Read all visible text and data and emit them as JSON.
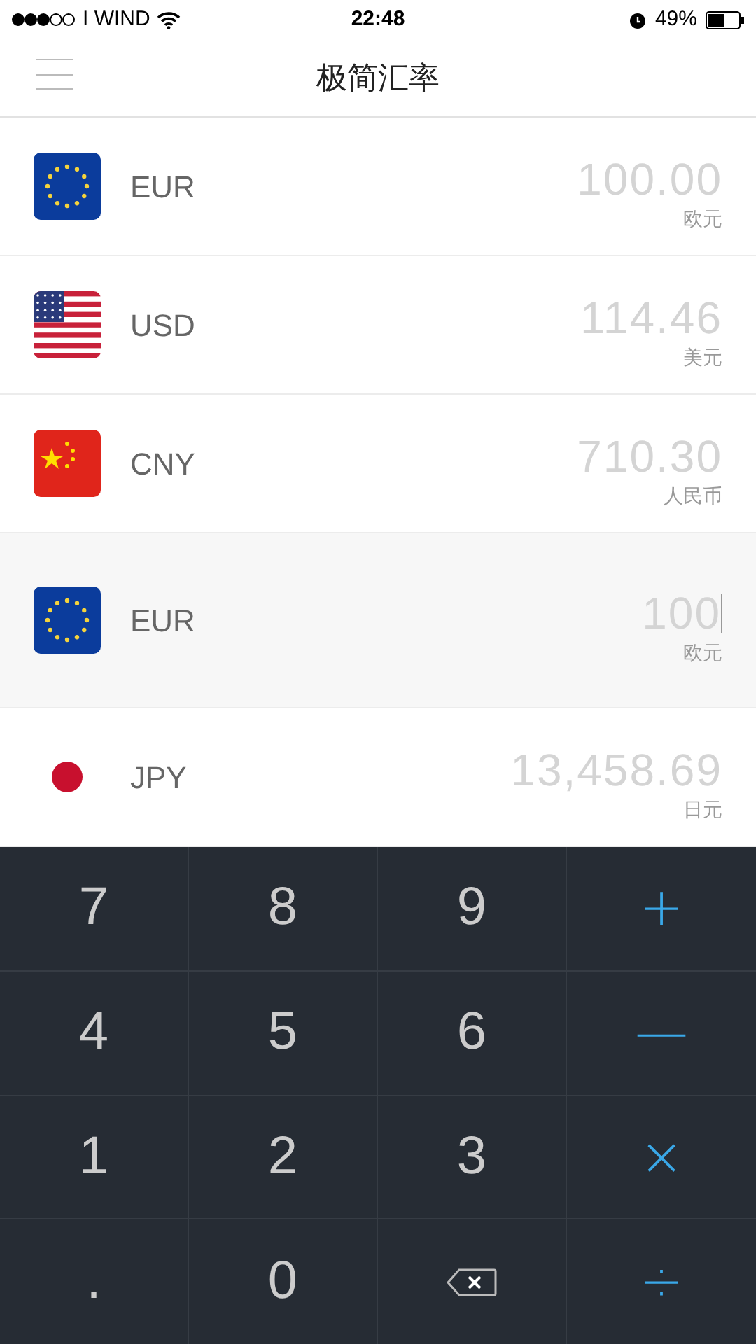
{
  "status_bar": {
    "carrier": "I WIND",
    "time": "22:48",
    "battery": "49%"
  },
  "header": {
    "title": "极简汇率"
  },
  "rows": [
    {
      "kind": "eu",
      "code": "EUR",
      "amount": "100.00",
      "name": "欧元",
      "selected": false
    },
    {
      "kind": "us",
      "code": "USD",
      "amount": "114.46",
      "name": "美元",
      "selected": false
    },
    {
      "kind": "cn",
      "code": "CNY",
      "amount": "710.30",
      "name": "人民币",
      "selected": false
    },
    {
      "kind": "eu",
      "code": "EUR",
      "amount": "100",
      "name": "欧元",
      "selected": true
    },
    {
      "kind": "jp",
      "code": "JPY",
      "amount": "13,458.69",
      "name": "日元",
      "selected": false
    }
  ],
  "keypad": [
    {
      "kind": "digit",
      "label": "7"
    },
    {
      "kind": "digit",
      "label": "8"
    },
    {
      "kind": "digit",
      "label": "9"
    },
    {
      "kind": "op",
      "label": "+"
    },
    {
      "kind": "digit",
      "label": "4"
    },
    {
      "kind": "digit",
      "label": "5"
    },
    {
      "kind": "digit",
      "label": "6"
    },
    {
      "kind": "op",
      "label": "—"
    },
    {
      "kind": "digit",
      "label": "1"
    },
    {
      "kind": "digit",
      "label": "2"
    },
    {
      "kind": "digit",
      "label": "3"
    },
    {
      "kind": "op",
      "label": "×"
    },
    {
      "kind": "digit",
      "label": "."
    },
    {
      "kind": "digit",
      "label": "0"
    },
    {
      "kind": "backspace"
    },
    {
      "kind": "op",
      "label": "÷"
    }
  ]
}
